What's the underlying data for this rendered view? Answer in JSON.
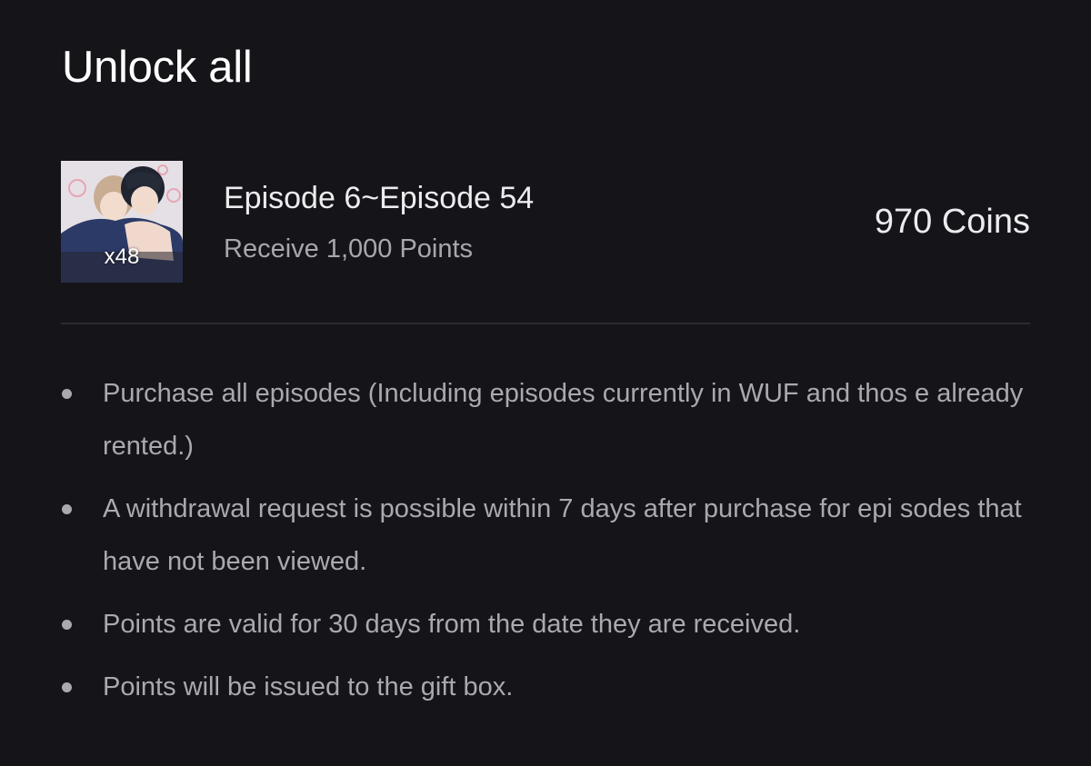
{
  "header": {
    "title": "Unlock all"
  },
  "bundle": {
    "thumbnail_count": "x48",
    "episode_range": "Episode 6~Episode 54",
    "reward": "Receive 1,000 Points",
    "price": "970 Coins"
  },
  "notes": [
    "Purchase all episodes (Including episodes currently in WUF and thos e already rented.)",
    "A withdrawal request is possible within 7 days after purchase for epi sodes that have not been viewed.",
    "Points are valid for 30 days from the date they are received.",
    "Points will be issued to the gift box."
  ],
  "colors": {
    "background": "#151419",
    "title": "#ffffff",
    "primary_text": "#ececef",
    "secondary_text": "#a7a7ad",
    "divider": "#2c2b31"
  }
}
